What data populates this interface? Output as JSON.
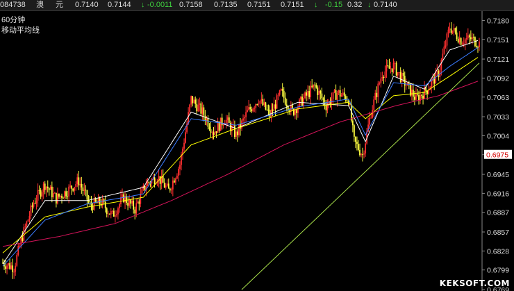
{
  "quote": {
    "code": "084738",
    "name_1": "澳",
    "name_2": "元",
    "open": "0.7140",
    "prev": "0.7144",
    "change_arrow": "↓",
    "change": "-0.0011",
    "high": "0.7158",
    "low": "0.7135",
    "last1": "0.7151",
    "last2": "0.7151",
    "pct_arrow": "↓",
    "pct": "-0.15",
    "vol": "0.32",
    "last_arrow": "↓",
    "last": "0.7140"
  },
  "panel": {
    "period": "60分钟",
    "indicator": "移动平均线",
    "watermark": "KEKSOFT.COM"
  },
  "colors": {
    "up": "#ff3030",
    "down": "#ffff40",
    "ma1": "#ffffff",
    "ma2": "#ffff00",
    "ma3": "#3a7bff",
    "ma4": "#d4145a",
    "trend": "#a8e04a",
    "current_price_bg": "#ffffff"
  },
  "chart_data": {
    "type": "candlestick",
    "y_axis_ticks": [
      "0.7180",
      "0.7151",
      "0.7121",
      "0.7092",
      "0.7063",
      "0.7033",
      "0.7004",
      "0.6975",
      "0.6945",
      "0.6916",
      "0.6887",
      "0.6857",
      "0.6828",
      "0.6799",
      "0.6769"
    ],
    "current_price": "0.6975",
    "ylim": [
      0.6769,
      0.719
    ],
    "price_path": [
      {
        "t": 0,
        "v": 0.681
      },
      {
        "t": 8,
        "v": 0.6803
      },
      {
        "t": 14,
        "v": 0.6851
      },
      {
        "t": 22,
        "v": 0.6902
      },
      {
        "t": 30,
        "v": 0.693
      },
      {
        "t": 38,
        "v": 0.6908
      },
      {
        "t": 46,
        "v": 0.692
      },
      {
        "t": 54,
        "v": 0.6935
      },
      {
        "t": 62,
        "v": 0.6898
      },
      {
        "t": 70,
        "v": 0.6902
      },
      {
        "t": 78,
        "v": 0.6882
      },
      {
        "t": 86,
        "v": 0.691
      },
      {
        "t": 94,
        "v": 0.6892
      },
      {
        "t": 102,
        "v": 0.693
      },
      {
        "t": 110,
        "v": 0.6942
      },
      {
        "t": 118,
        "v": 0.692
      },
      {
        "t": 126,
        "v": 0.696
      },
      {
        "t": 134,
        "v": 0.706
      },
      {
        "t": 142,
        "v": 0.704
      },
      {
        "t": 150,
        "v": 0.701
      },
      {
        "t": 158,
        "v": 0.703
      },
      {
        "t": 166,
        "v": 0.7005
      },
      {
        "t": 174,
        "v": 0.704
      },
      {
        "t": 182,
        "v": 0.706
      },
      {
        "t": 190,
        "v": 0.7035
      },
      {
        "t": 198,
        "v": 0.707
      },
      {
        "t": 206,
        "v": 0.704
      },
      {
        "t": 214,
        "v": 0.706
      },
      {
        "t": 222,
        "v": 0.708
      },
      {
        "t": 230,
        "v": 0.705
      },
      {
        "t": 238,
        "v": 0.707
      },
      {
        "t": 246,
        "v": 0.706
      },
      {
        "t": 250,
        "v": 0.6995
      },
      {
        "t": 256,
        "v": 0.6975
      },
      {
        "t": 262,
        "v": 0.704
      },
      {
        "t": 270,
        "v": 0.71
      },
      {
        "t": 278,
        "v": 0.711
      },
      {
        "t": 286,
        "v": 0.7085
      },
      {
        "t": 294,
        "v": 0.706
      },
      {
        "t": 302,
        "v": 0.7075
      },
      {
        "t": 310,
        "v": 0.71
      },
      {
        "t": 318,
        "v": 0.717
      },
      {
        "t": 326,
        "v": 0.715
      },
      {
        "t": 333,
        "v": 0.7152
      },
      {
        "t": 339,
        "v": 0.7145
      }
    ],
    "moving_averages": [
      {
        "key": "ma1",
        "points": [
          [
            0,
            0.6808
          ],
          [
            30,
            0.6905
          ],
          [
            60,
            0.6905
          ],
          [
            100,
            0.6925
          ],
          [
            134,
            0.704
          ],
          [
            166,
            0.7015
          ],
          [
            210,
            0.7055
          ],
          [
            246,
            0.705
          ],
          [
            258,
            0.6995
          ],
          [
            278,
            0.7095
          ],
          [
            300,
            0.7075
          ],
          [
            318,
            0.7135
          ],
          [
            339,
            0.715
          ]
        ]
      },
      {
        "key": "ma2",
        "points": [
          [
            0,
            0.6825
          ],
          [
            30,
            0.688
          ],
          [
            60,
            0.6895
          ],
          [
            100,
            0.691
          ],
          [
            134,
            0.699
          ],
          [
            166,
            0.7015
          ],
          [
            210,
            0.7045
          ],
          [
            246,
            0.7055
          ],
          [
            258,
            0.703
          ],
          [
            278,
            0.7065
          ],
          [
            300,
            0.707
          ],
          [
            318,
            0.7095
          ],
          [
            339,
            0.7125
          ]
        ]
      },
      {
        "key": "ma3",
        "points": [
          [
            0,
            0.6805
          ],
          [
            30,
            0.6875
          ],
          [
            60,
            0.69
          ],
          [
            100,
            0.6915
          ],
          [
            134,
            0.703
          ],
          [
            166,
            0.702
          ],
          [
            210,
            0.7048
          ],
          [
            246,
            0.706
          ],
          [
            258,
            0.7005
          ],
          [
            278,
            0.7085
          ],
          [
            300,
            0.708
          ],
          [
            318,
            0.711
          ],
          [
            339,
            0.714
          ]
        ]
      },
      {
        "key": "ma4",
        "points": [
          [
            0,
            0.6835
          ],
          [
            40,
            0.685
          ],
          [
            80,
            0.687
          ],
          [
            120,
            0.6905
          ],
          [
            160,
            0.6945
          ],
          [
            200,
            0.699
          ],
          [
            240,
            0.7025
          ],
          [
            280,
            0.705
          ],
          [
            310,
            0.7065
          ],
          [
            339,
            0.7088
          ]
        ]
      }
    ],
    "trendline": [
      [
        170,
        0.6769
      ],
      [
        339,
        0.7115
      ]
    ]
  }
}
